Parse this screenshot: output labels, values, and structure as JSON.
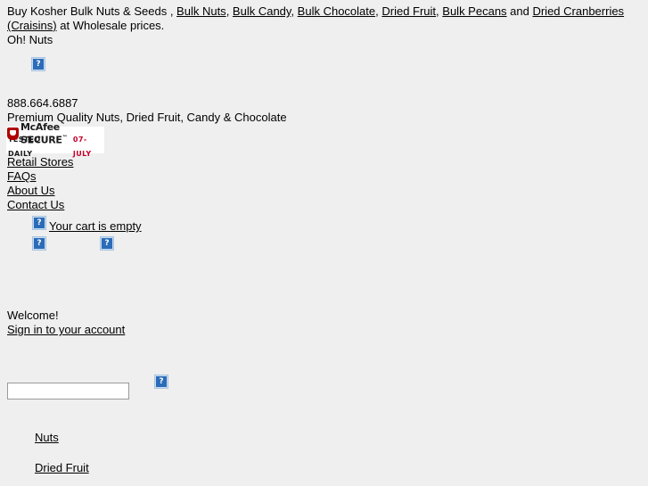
{
  "page": {
    "background_color": "#efefef",
    "text_color": "#000000"
  },
  "tagline": {
    "lead": "Buy Kosher Bulk Nuts & Seeds , ",
    "links": [
      "Bulk Nuts",
      "Bulk Candy",
      "Bulk Chocolate",
      "Dried Fruit",
      "Bulk Pecans",
      "Dried Cranberries (Craisins)"
    ],
    "sep": ", ",
    "and_word": " and ",
    "tail": " at Wholesale prices.",
    "brand": "Oh! Nuts"
  },
  "contact": {
    "phone": "888.664.6887",
    "slogan": "Premium Quality Nuts, Dried Fruit, Candy & Chocolate"
  },
  "mcafee": {
    "brand": "McAfee SECURE",
    "trademark": "™",
    "tested_label": "TESTED DAILY",
    "date": "07-JULY",
    "shield_color": "#b00000",
    "date_color": "#c4002a"
  },
  "nav": {
    "items": [
      "Retail Stores",
      "FAQs",
      "About Us",
      "Contact Us"
    ]
  },
  "cart": {
    "status": "Your cart is empty"
  },
  "account": {
    "welcome": "Welcome!",
    "signin": "Sign in to your account"
  },
  "search": {
    "value": "",
    "placeholder": ""
  },
  "categories": [
    "Nuts",
    "Dried Fruit"
  ],
  "icons": {
    "broken_image": "?",
    "logo_placeholder": "broken-image-icon",
    "cart_placeholder": "broken-image-icon",
    "search_placeholder": "broken-image-icon"
  }
}
